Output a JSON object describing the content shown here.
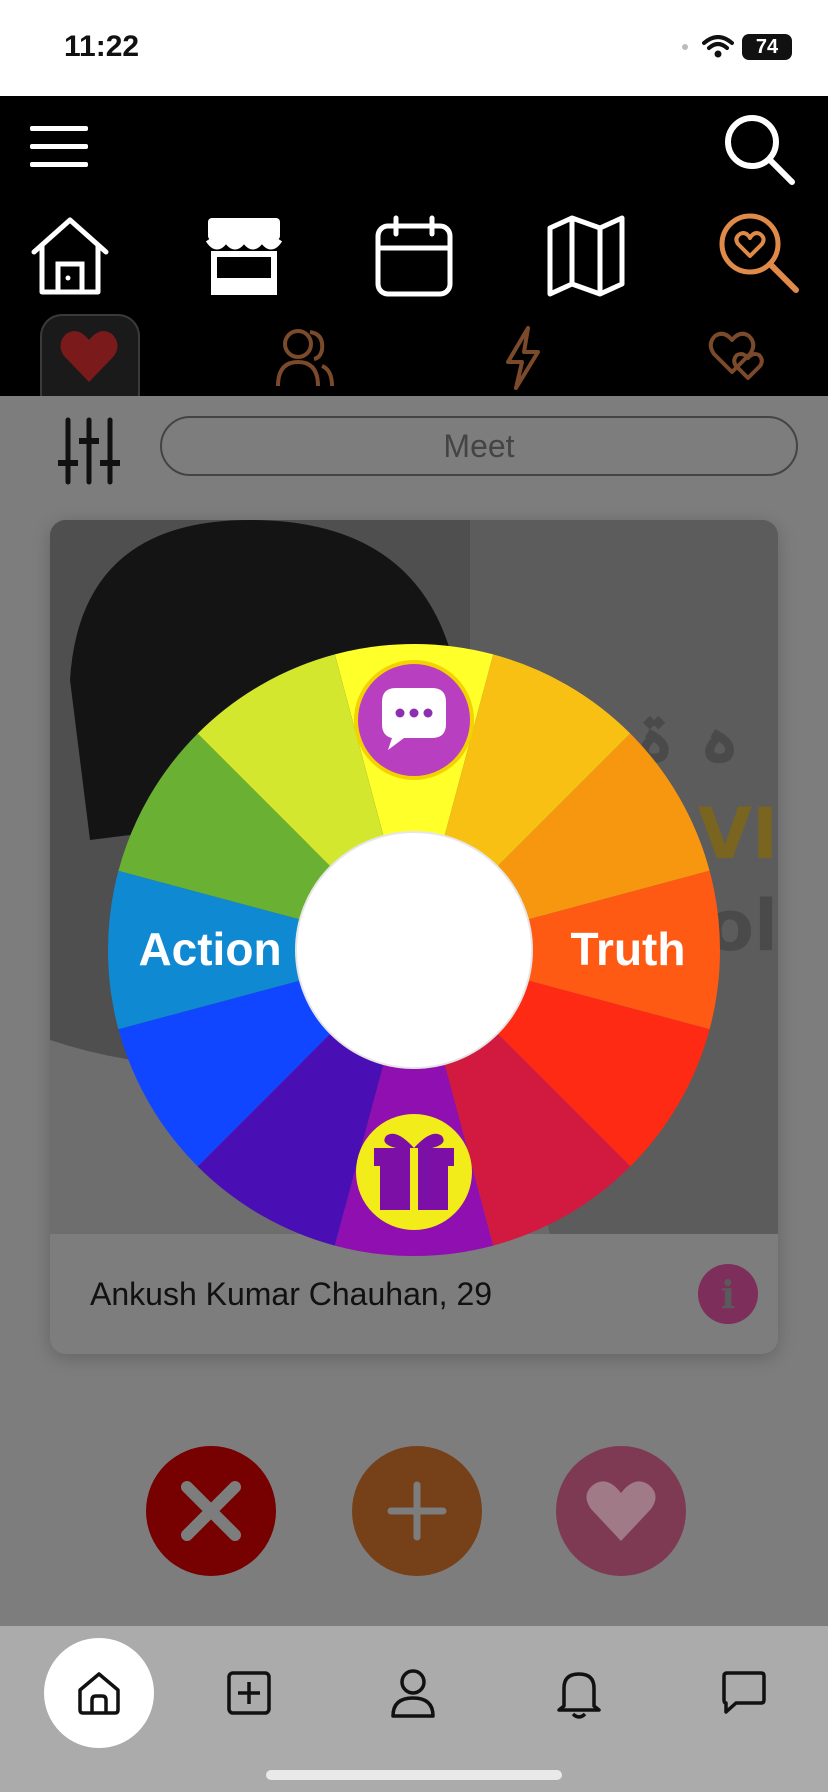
{
  "status": {
    "time": "11:22",
    "battery": "74"
  },
  "top_nav": {
    "icons": [
      "menu-icon",
      "search-icon",
      "home-icon",
      "store-icon",
      "calendar-icon",
      "map-icon",
      "love-search-icon"
    ],
    "sub_tabs": [
      "heart-icon",
      "people-icon",
      "bolt-icon",
      "double-heart-icon"
    ],
    "active_accent": "#e08a4a"
  },
  "filter": {
    "meet_label": "Meet"
  },
  "card": {
    "name": "Ankush Kumar Chauhan, 29",
    "info_symbol": "i"
  },
  "wheel": {
    "left_label": "Action",
    "right_label": "Truth",
    "top_icon": "chat-bubble-icon",
    "bottom_icon": "gift-icon",
    "segment_colors": [
      "#ffff2a",
      "#f7c013",
      "#f7960f",
      "#ff5a14",
      "#ff2a14",
      "#d21a40",
      "#8f0fb0",
      "#4a0fb4",
      "#1046ff",
      "#0f89d1",
      "#6ab033",
      "#d2e72e"
    ]
  },
  "actions": {
    "dislike": "close-icon",
    "add": "plus-icon",
    "like": "heart-icon"
  },
  "bottom_nav": [
    "home-icon",
    "add-square-icon",
    "profile-icon",
    "bell-icon",
    "chat-icon"
  ]
}
